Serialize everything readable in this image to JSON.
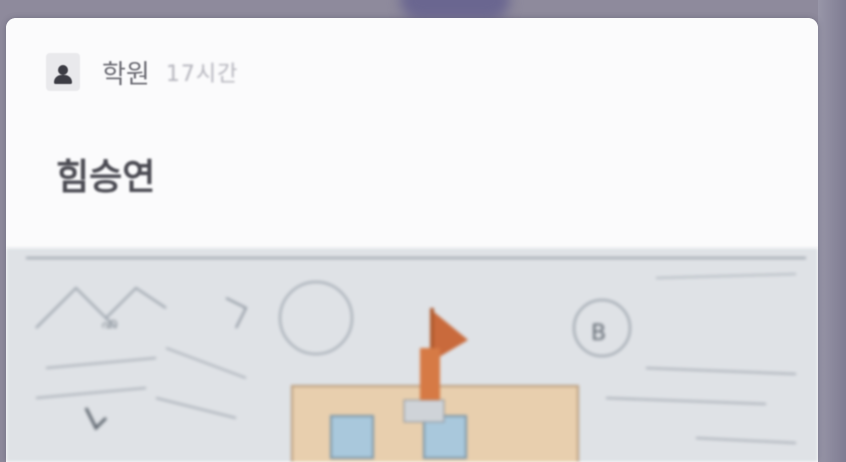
{
  "notification": {
    "app_icon": "student-avatar-icon",
    "sender": "학원",
    "time": "17시간",
    "title": "힘승연"
  },
  "preview": {
    "kind": "photo of hand-drawn sketch of a house with a flag",
    "colors": {
      "paper": "#dfe2e6",
      "house": "#e8cfae",
      "windows": "#a9c8dc",
      "flag": "#c96a3c"
    }
  }
}
